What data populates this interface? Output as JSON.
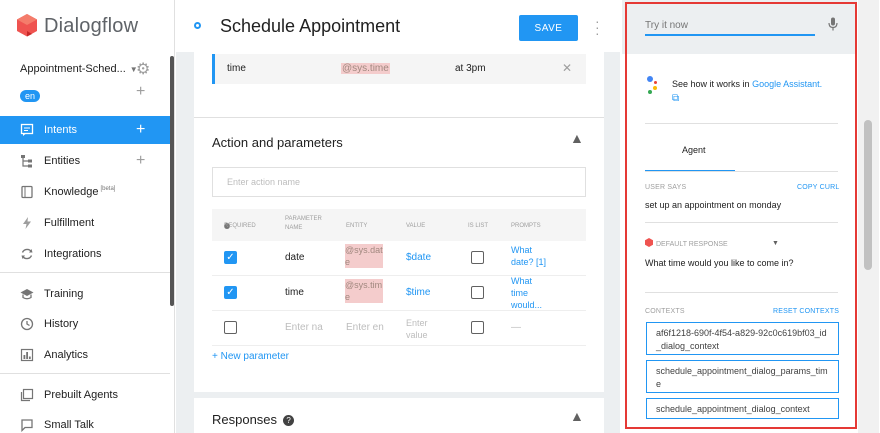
{
  "app": {
    "name": "Dialogflow"
  },
  "sidebar": {
    "agent_name": "Appointment-Sched...",
    "language": "en",
    "items": [
      {
        "label": "Intents",
        "icon": "chat-bubble-icon",
        "active": true,
        "has_add": true
      },
      {
        "label": "Entities",
        "icon": "tree-icon",
        "active": false,
        "has_add": true
      },
      {
        "label": "Knowledge",
        "badge": "[beta]",
        "icon": "book-icon",
        "active": false
      },
      {
        "label": "Fulfillment",
        "icon": "bolt-icon",
        "active": false
      },
      {
        "label": "Integrations",
        "icon": "sync-icon",
        "active": false
      },
      {
        "label": "Training",
        "icon": "graduation-cap-icon",
        "active": false
      },
      {
        "label": "History",
        "icon": "clock-icon",
        "active": false
      },
      {
        "label": "Analytics",
        "icon": "bar-chart-icon",
        "active": false
      },
      {
        "label": "Prebuilt Agents",
        "icon": "library-icon",
        "active": false
      },
      {
        "label": "Small Talk",
        "icon": "chat-icon",
        "active": false
      }
    ]
  },
  "header": {
    "title": "Schedule Appointment",
    "save_label": "SAVE"
  },
  "training_param_row": {
    "name": "time",
    "entity": "@sys.time",
    "value": "at 3pm"
  },
  "action_section": {
    "title": "Action and parameters",
    "action_placeholder": "Enter action name",
    "columns": [
      "REQUIRED",
      "PARAMETER NAME",
      "ENTITY",
      "VALUE",
      "IS LIST",
      "PROMPTS"
    ],
    "rows": [
      {
        "required": true,
        "name": "date",
        "entity": "@sys.date",
        "value": "$date",
        "is_list": false,
        "prompts": "What date? [1]"
      },
      {
        "required": true,
        "name": "time",
        "entity": "@sys.time",
        "value": "$time",
        "is_list": false,
        "prompts": "What time would..."
      },
      {
        "required": false,
        "name_placeholder": "Enter na",
        "entity_placeholder": "Enter en",
        "value_placeholder": "Enter value",
        "is_list": false,
        "prompts": "—"
      }
    ],
    "new_parameter_label": "+ New parameter"
  },
  "responses_section": {
    "title": "Responses"
  },
  "test_panel": {
    "try_placeholder": "Try it now",
    "ga_text": "See how it works in",
    "ga_link": "Google Assistant.",
    "agent_tab": "Agent",
    "user_says_label": "USER SAYS",
    "copy_curl_label": "COPY CURL",
    "user_says": "set up an appointment on monday",
    "default_response_label": "DEFAULT RESPONSE",
    "response_text": "What time would you like to come in?",
    "contexts_label": "CONTEXTS",
    "reset_contexts_label": "RESET CONTEXTS",
    "contexts": [
      "af6f1218-690f-4f54-a829-92c0c619bf03_id_dialog_context",
      "schedule_appointment_dialog_params_time",
      "schedule_appointment_dialog_context"
    ]
  },
  "colors": {
    "accent": "#2196f3",
    "highlight_border": "#e53935",
    "logo": "#ef5350",
    "entity_bg": "#f4cccc"
  }
}
